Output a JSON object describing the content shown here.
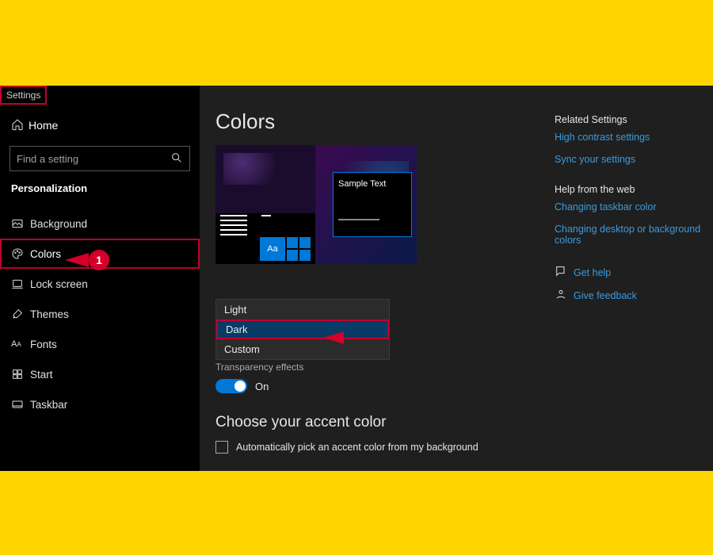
{
  "window": {
    "title": "Settings"
  },
  "sidebar": {
    "home": "Home",
    "search_placeholder": "Find a setting",
    "section": "Personalization",
    "items": [
      {
        "label": "Background",
        "icon": "image-icon"
      },
      {
        "label": "Colors",
        "icon": "palette-icon",
        "selected": true
      },
      {
        "label": "Lock screen",
        "icon": "lockscreen-icon"
      },
      {
        "label": "Themes",
        "icon": "brush-icon"
      },
      {
        "label": "Fonts",
        "icon": "font-icon"
      },
      {
        "label": "Start",
        "icon": "start-icon"
      },
      {
        "label": "Taskbar",
        "icon": "taskbar-icon"
      }
    ]
  },
  "main": {
    "title": "Colors",
    "preview_sample": "Sample Text",
    "preview_aa": "Aa",
    "mode_options": [
      "Light",
      "Dark",
      "Custom"
    ],
    "mode_selected": "Dark",
    "transparency_label": "Transparency effects",
    "transparency_state": "On",
    "accent_heading": "Choose your accent color",
    "auto_accent_label": "Automatically pick an accent color from my background"
  },
  "right": {
    "related_heading": "Related Settings",
    "related_links": [
      "High contrast settings",
      "Sync your settings"
    ],
    "help_heading": "Help from the web",
    "help_links": [
      "Changing taskbar color",
      "Changing desktop or background colors"
    ],
    "get_help": "Get help",
    "give_feedback": "Give feedback"
  },
  "annotations": {
    "badge1": "1"
  },
  "colors": {
    "accent": "#0078D7",
    "highlight": "#C00030"
  }
}
